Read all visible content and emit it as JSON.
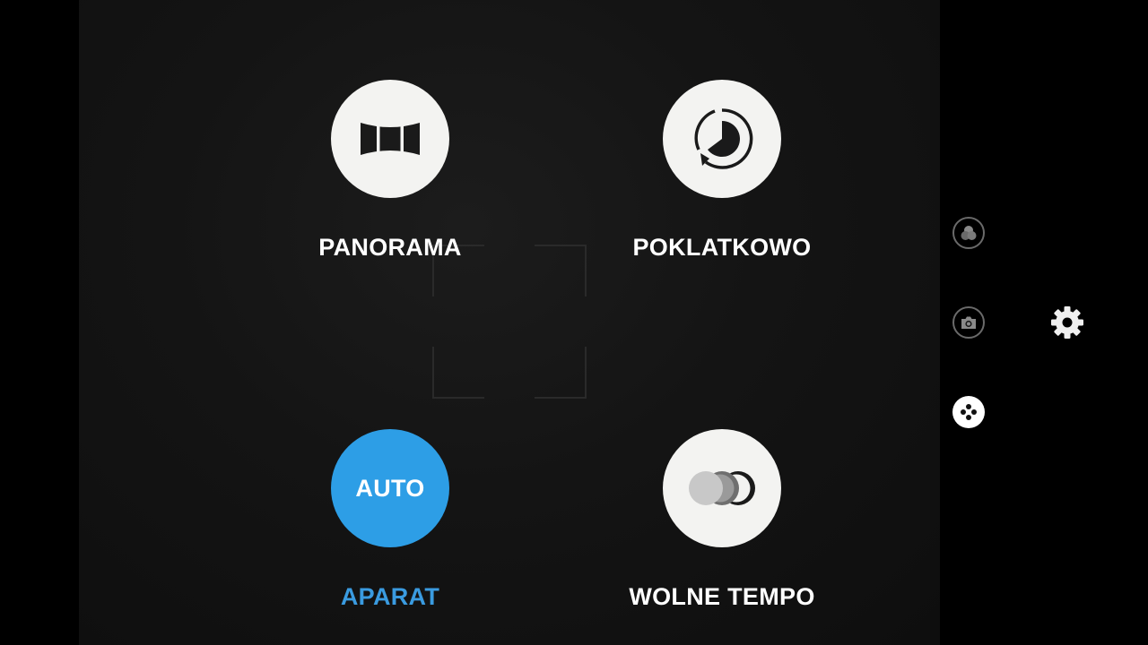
{
  "modes": {
    "panorama": {
      "label": "PANORAMA",
      "icon": "panorama-icon"
    },
    "timelapse": {
      "label": "POKLATKOWO",
      "icon": "timelapse-icon"
    },
    "auto": {
      "label": "APARAT",
      "badge": "AUTO",
      "active": true
    },
    "slowmo": {
      "label": "WOLNE TEMPO",
      "icon": "slow-motion-icon"
    }
  },
  "sidebar": {
    "items": [
      {
        "icon": "filter-icon"
      },
      {
        "icon": "switch-camera-icon"
      },
      {
        "icon": "modes-icon",
        "active": true
      },
      {
        "icon": "gear-icon"
      }
    ]
  },
  "colors": {
    "accent": "#2d9ee6",
    "accent_text": "#3a9be0",
    "circle": "#f3f3f1",
    "icon_dark": "#1a1a1a",
    "background": "#000000"
  }
}
